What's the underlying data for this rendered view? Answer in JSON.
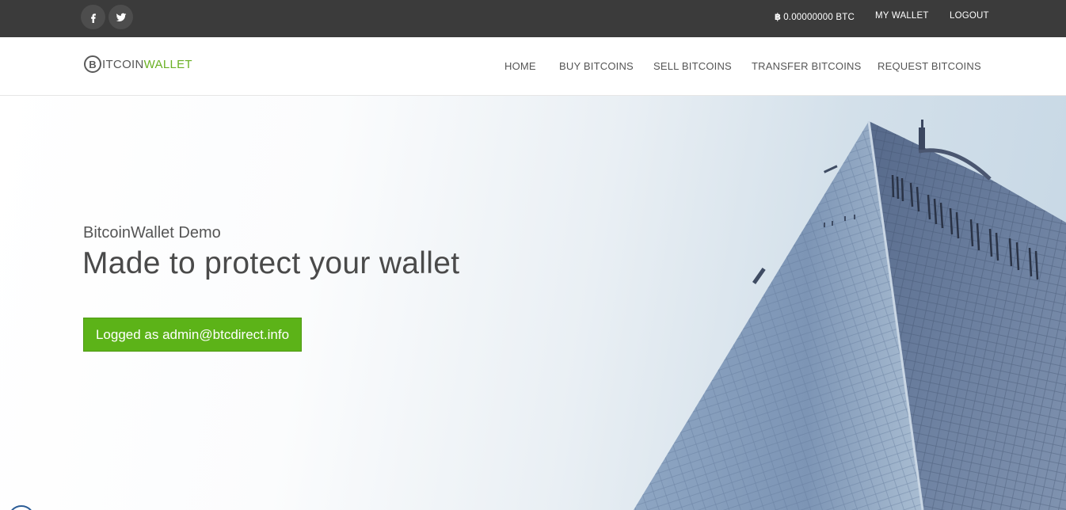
{
  "topbar": {
    "social": [
      {
        "icon": "facebook-icon"
      },
      {
        "icon": "twitter-icon"
      }
    ],
    "balance_symbol": "฿",
    "balance": "0.00000000 BTC",
    "my_wallet": "MY WALLET",
    "logout": "LOGOUT"
  },
  "logo": {
    "coin_letter": "B",
    "part1": "ITCOIN",
    "part2": "WALLET"
  },
  "nav": {
    "items": [
      "HOME",
      "BUY BITCOINS",
      "SELL BITCOINS",
      "TRANSFER BITCOINS",
      "REQUEST BITCOINS"
    ]
  },
  "hero": {
    "subtitle": "BitcoinWallet Demo",
    "title": "Made to protect your wallet",
    "button": "Logged as admin@btcdirect.info"
  },
  "colors": {
    "topbar": "#3b3b3b",
    "accent_green": "#5cb318",
    "text_dark": "#4a4a4a"
  }
}
